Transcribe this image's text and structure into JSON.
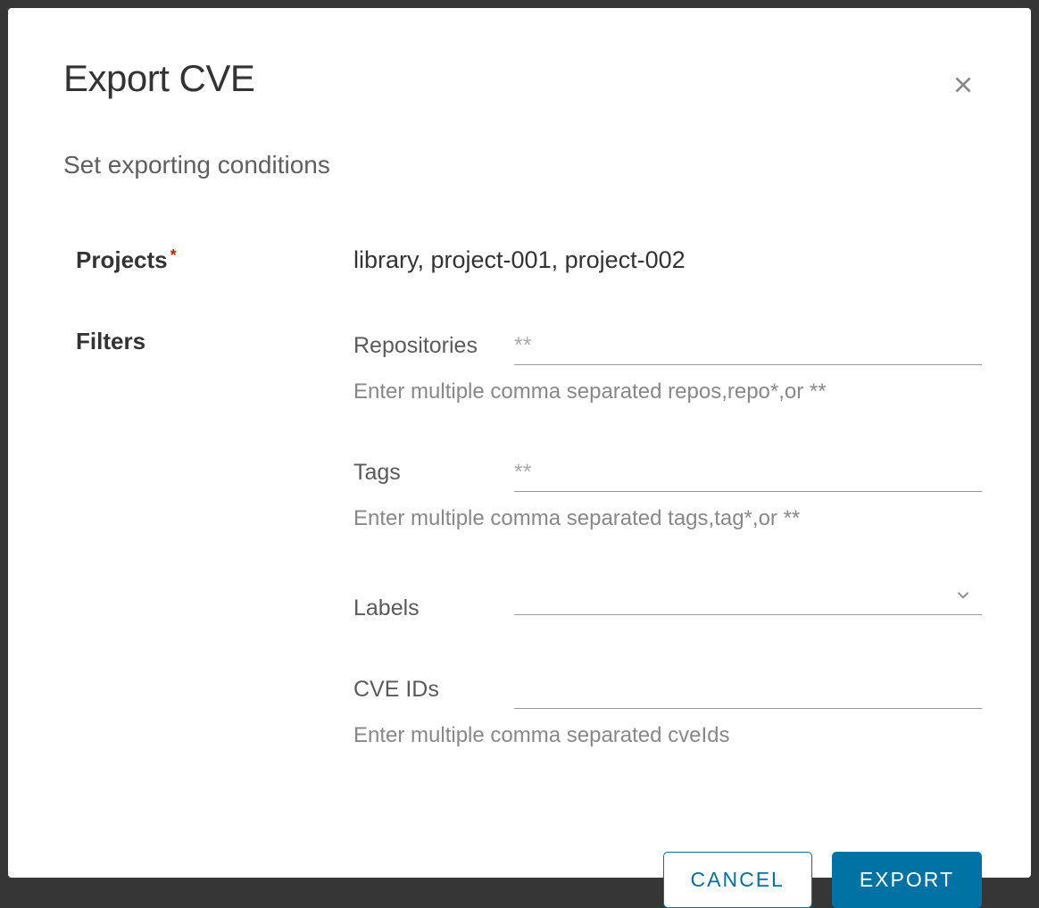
{
  "modal": {
    "title": "Export CVE",
    "subtitle": "Set exporting conditions"
  },
  "form": {
    "projects_label": "Projects",
    "projects_value": "library, project-001, project-002",
    "filters_label": "Filters",
    "filters": {
      "repositories": {
        "label": "Repositories",
        "placeholder": "**",
        "value": "",
        "hint": "Enter multiple comma separated repos,repo*,or **"
      },
      "tags": {
        "label": "Tags",
        "placeholder": "**",
        "value": "",
        "hint": "Enter multiple comma separated tags,tag*,or **"
      },
      "labels": {
        "label": "Labels",
        "value": ""
      },
      "cve_ids": {
        "label": "CVE IDs",
        "placeholder": "",
        "value": "",
        "hint": "Enter multiple comma separated cveIds"
      }
    }
  },
  "actions": {
    "cancel": "CANCEL",
    "export": "EXPORT"
  }
}
